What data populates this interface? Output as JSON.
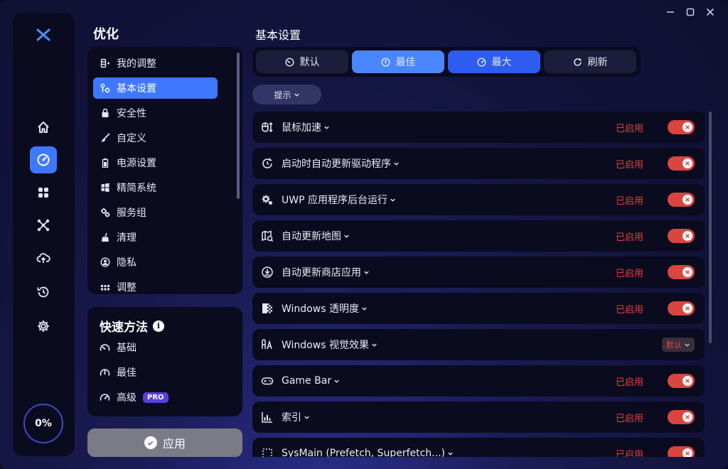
{
  "sidebar": {
    "progress": "0%"
  },
  "nav": {
    "title": "优化",
    "items": [
      {
        "label": "我的调整",
        "icon": "my-tweaks-icon"
      },
      {
        "label": "基本设置",
        "icon": "basic-settings-icon",
        "active": true
      },
      {
        "label": "安全性",
        "icon": "lock-icon"
      },
      {
        "label": "自定义",
        "icon": "brush-icon"
      },
      {
        "label": "电源设置",
        "icon": "battery-icon"
      },
      {
        "label": "精简系统",
        "icon": "windows-icon"
      },
      {
        "label": "服务组",
        "icon": "gears-icon"
      },
      {
        "label": "清理",
        "icon": "broom-icon"
      },
      {
        "label": "隐私",
        "icon": "privacy-icon"
      },
      {
        "label": "调整",
        "icon": "grid-icon"
      }
    ]
  },
  "quick": {
    "title": "快速方法",
    "items": [
      {
        "label": "基础"
      },
      {
        "label": "最佳"
      },
      {
        "label": "高级",
        "badge": "PRO"
      }
    ]
  },
  "apply_label": "应用",
  "content": {
    "title": "基本设置",
    "segments": [
      {
        "label": "默认"
      },
      {
        "label": "最佳"
      },
      {
        "label": "最大"
      },
      {
        "label": "刷新"
      }
    ],
    "hint_label": "提示",
    "rows": [
      {
        "label": "鼠标加速",
        "status": "已启用",
        "icon": "mouse-icon"
      },
      {
        "label": "启动时自动更新驱动程序",
        "status": "已启用",
        "icon": "refresh-clock-icon"
      },
      {
        "label": "UWP 应用程序后台运行",
        "status": "已启用",
        "icon": "puzzle-gear-icon"
      },
      {
        "label": "自动更新地图",
        "status": "已启用",
        "icon": "map-icon"
      },
      {
        "label": "自动更新商店应用",
        "status": "已启用",
        "icon": "download-icon"
      },
      {
        "label": "Windows 透明度",
        "status": "已启用",
        "icon": "transparency-icon"
      },
      {
        "label": "Windows 视觉效果",
        "status": "默认",
        "icon": "font-effects-icon"
      },
      {
        "label": "Game Bar",
        "status": "已启用",
        "icon": "gamepad-icon"
      },
      {
        "label": "索引",
        "status": "已启用",
        "icon": "index-chart-icon"
      },
      {
        "label": "SysMain (Prefetch, Superfetch...)",
        "status": "已启用",
        "icon": "sysmain-icon"
      }
    ]
  },
  "colors": {
    "accent": "#3e78ff",
    "enabled_red": "#d9453f"
  }
}
